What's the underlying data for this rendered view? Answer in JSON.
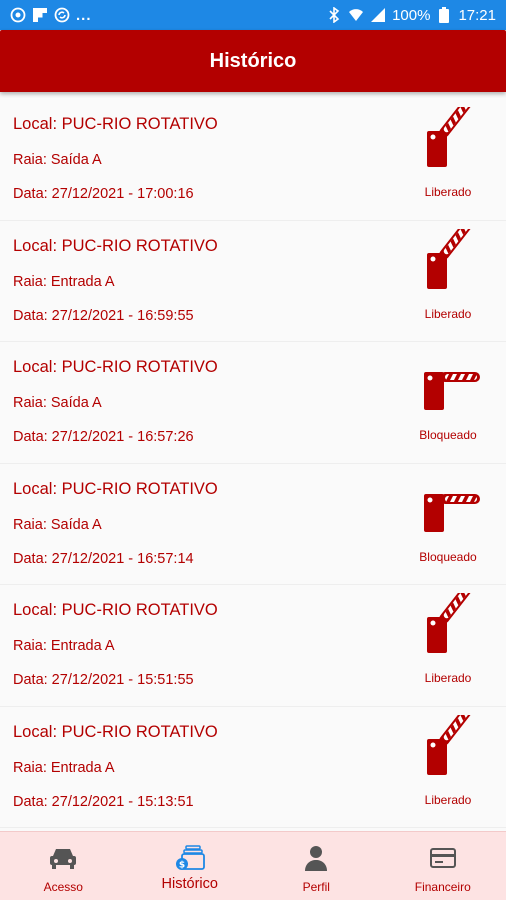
{
  "status_bar": {
    "battery": "100%",
    "time": "17:21",
    "icons": [
      "vpn-icon",
      "flipboard-icon",
      "vpn-icon",
      "more-dots",
      "bluetooth-icon",
      "wifi-icon",
      "signal-icon",
      "battery-icon"
    ]
  },
  "header": {
    "title": "Histórico"
  },
  "records": [
    {
      "local": "Local: PUC-RIO ROTATIVO",
      "raia": "Raia: Saída A",
      "data": "Data: 27/12/2021 - 17:00:16",
      "status": "Liberado",
      "state": "open"
    },
    {
      "local": "Local: PUC-RIO ROTATIVO",
      "raia": "Raia: Entrada A",
      "data": "Data: 27/12/2021 - 16:59:55",
      "status": "Liberado",
      "state": "open"
    },
    {
      "local": "Local: PUC-RIO ROTATIVO",
      "raia": "Raia: Saída A",
      "data": "Data: 27/12/2021 - 16:57:26",
      "status": "Bloqueado",
      "state": "closed"
    },
    {
      "local": "Local: PUC-RIO ROTATIVO",
      "raia": "Raia: Saída A",
      "data": "Data: 27/12/2021 - 16:57:14",
      "status": "Bloqueado",
      "state": "closed"
    },
    {
      "local": "Local: PUC-RIO ROTATIVO",
      "raia": "Raia: Entrada A",
      "data": "Data: 27/12/2021 - 15:51:55",
      "status": "Liberado",
      "state": "open"
    },
    {
      "local": "Local: PUC-RIO ROTATIVO",
      "raia": "Raia: Entrada A",
      "data": "Data: 27/12/2021 - 15:13:51",
      "status": "Liberado",
      "state": "open"
    }
  ],
  "bottom_nav": [
    {
      "label": "Acesso",
      "icon": "car-icon",
      "active": false
    },
    {
      "label": "Histórico",
      "icon": "history-icon",
      "active": true
    },
    {
      "label": "Perfil",
      "icon": "person-icon",
      "active": false
    },
    {
      "label": "Financeiro",
      "icon": "card-icon",
      "active": false
    }
  ],
  "colors": {
    "primary": "#b30000",
    "status_bar": "#1e88e5",
    "nav_bg": "#fde3e3"
  }
}
